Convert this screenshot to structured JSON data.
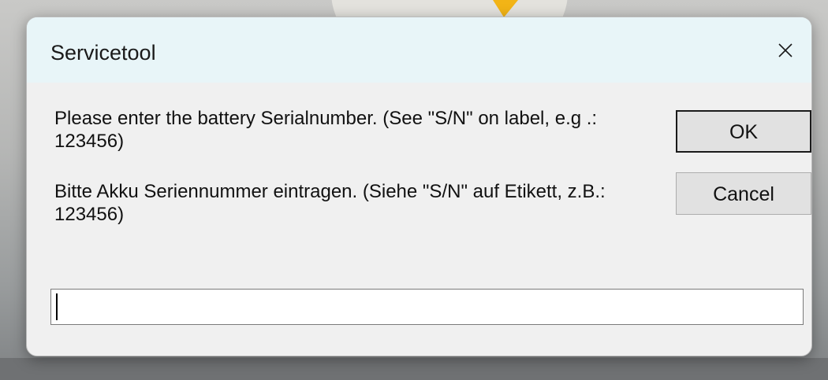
{
  "dialog": {
    "title": "Servicetool",
    "close_icon": "close-icon",
    "message_en": "Please enter the battery Serialnumber. (See \"S/N\" on label, e.g .: 123456)",
    "message_de": "Bitte Akku Seriennummer eintragen. (Siehe \"S/N\" auf Etikett, z.B.: 123456)",
    "ok_label": "OK",
    "cancel_label": "Cancel",
    "serial_input": {
      "value": "",
      "placeholder": ""
    }
  },
  "colors": {
    "titlebar_bg": "#e8f5f8",
    "dialog_bg": "#f0f0f0",
    "button_bg": "#e1e1e1",
    "backdrop_accent": "#f2b416"
  }
}
